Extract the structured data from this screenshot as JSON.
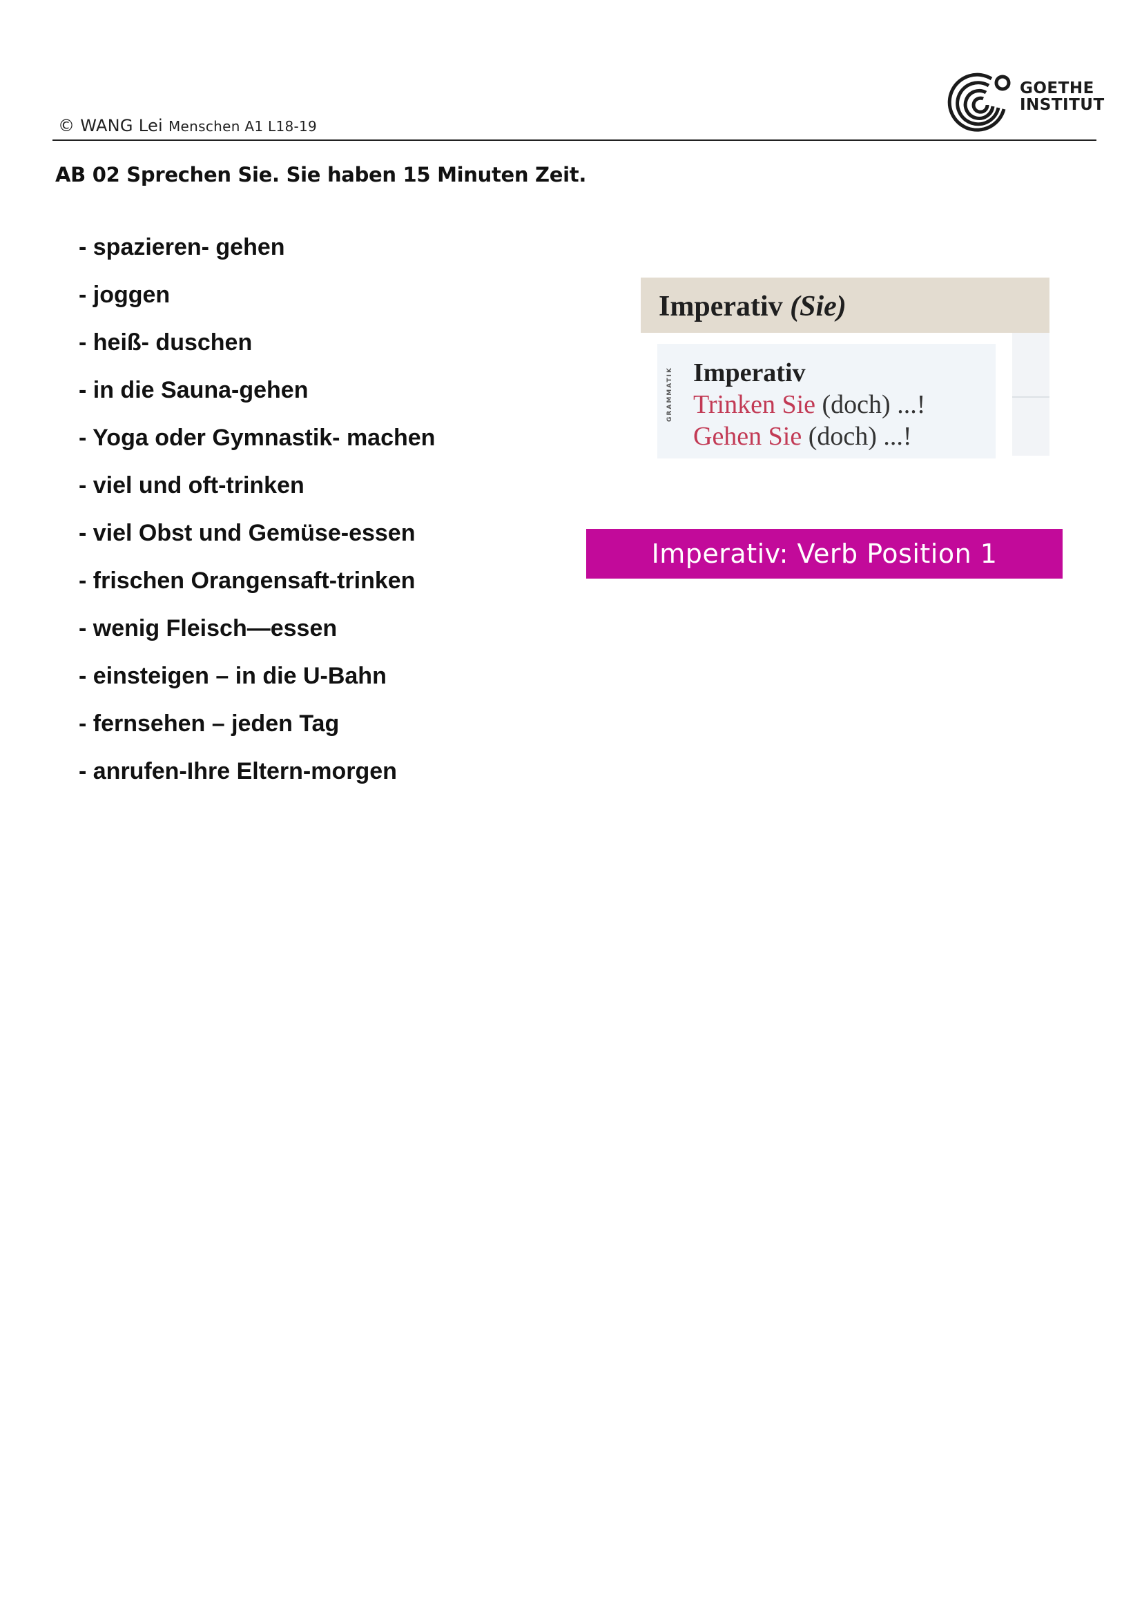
{
  "header": {
    "copyright": "© WANG Lei",
    "course": "Menschen A1 L18-19"
  },
  "logo": {
    "line1": "GOETHE",
    "line2": "INSTITUT"
  },
  "task": {
    "title": "AB 02 Sprechen Sie. Sie haben 15  Minuten Zeit."
  },
  "phrases": [
    "- spazieren- gehen",
    "- joggen",
    "- heiß- duschen",
    "- in die Sauna-gehen",
    "- Yoga oder Gymnastik- machen",
    "- viel und oft-trinken",
    "- viel Obst und Gemüse-essen",
    "- frischen Orangensaft-trinken",
    "- wenig Fleisch—essen",
    "- einsteigen – in die U-Bahn",
    "- fernsehen – jeden Tag",
    "- anrufen-Ihre Eltern-morgen"
  ],
  "grammar_card": {
    "title_main": "Imperativ",
    "title_paren": "(Sie)",
    "side_label": "GRAMMATIK",
    "heading": "Imperativ",
    "example1_red": "Trinken Sie",
    "example1_rest": " (doch) ...!",
    "example2_red": "Gehen Sie",
    "example2_rest": " (doch) ...!"
  },
  "banner": {
    "text": "Imperativ: Verb Position 1"
  },
  "colors": {
    "banner_bg": "#c20a9a",
    "card_header_bg": "#e3dcd0",
    "example_red": "#c23a55"
  }
}
